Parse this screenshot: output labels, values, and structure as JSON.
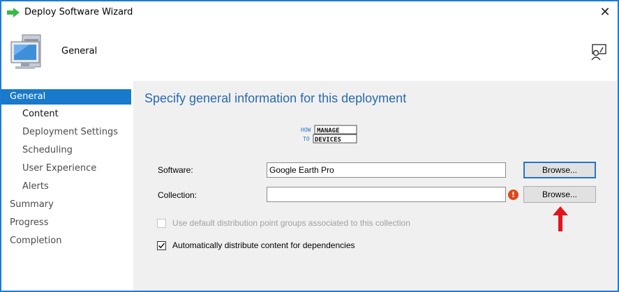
{
  "window": {
    "title": "Deploy Software Wizard",
    "close_glyph": "✕"
  },
  "header": {
    "label": "General",
    "icon": "computer-icon",
    "help_icon": "help-icon"
  },
  "sidebar": {
    "items": [
      {
        "label": "General",
        "active": true
      },
      {
        "label": "Content"
      },
      {
        "label": "Deployment Settings"
      },
      {
        "label": "Scheduling"
      },
      {
        "label": "User Experience"
      },
      {
        "label": "Alerts"
      },
      {
        "label": "Summary"
      },
      {
        "label": "Progress"
      },
      {
        "label": "Completion"
      }
    ]
  },
  "main": {
    "heading": "Specify general information for this deployment",
    "logo": {
      "line1a": "HOW",
      "line1b": "MANAGE",
      "line2a": "TO",
      "line2b": "DEVICES"
    },
    "software": {
      "label": "Software:",
      "value": "Google Earth Pro",
      "browse_label": "Browse..."
    },
    "collection": {
      "label": "Collection:",
      "value": "",
      "browse_label": "Browse...",
      "error_glyph": "!"
    },
    "checkbox_default_dp": {
      "label": "Use default distribution point groups associated to this collection",
      "checked": false,
      "enabled": false
    },
    "checkbox_auto_distribute": {
      "label": "Automatically distribute content for dependencies",
      "checked": true,
      "enabled": true
    }
  },
  "colors": {
    "accent": "#1979ca",
    "heading": "#2a69b0",
    "arrow": "#e3141e",
    "error": "#d84a1b"
  }
}
